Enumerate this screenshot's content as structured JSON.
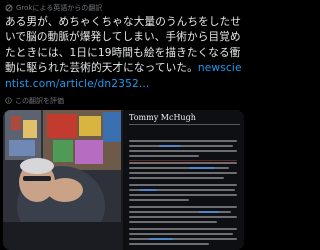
{
  "translated_by": "Grokによる英語からの翻訳",
  "post": {
    "text": "ある男が、めちゃくちゃな大量のうんちをしたせいで脳の動脈が爆発してしまい、手術から目覚めたときには、1日に19時間も絵を描きたくなる衝動に駆られた芸術的天才になっていた。",
    "link_part1": "newscientist.com/",
    "link_part2": "article/dn2352..."
  },
  "rate_label": "この翻訳を評価",
  "wiki": {
    "title": "Tommy McHugh"
  },
  "colors": {
    "background": "#000000",
    "text": "#e7e9ea",
    "muted": "#71767b",
    "link": "#1d9bf0"
  }
}
